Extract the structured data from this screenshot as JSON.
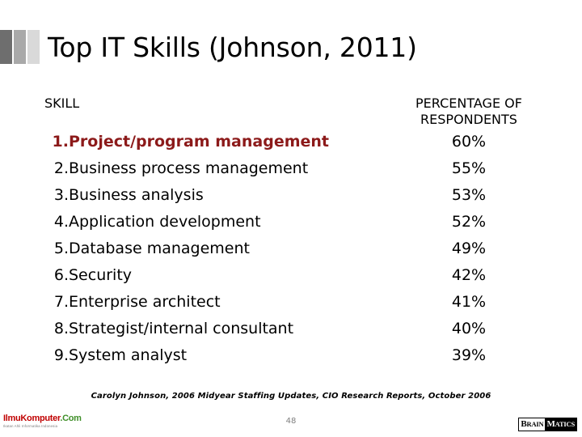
{
  "slide": {
    "title": "Top IT Skills (Johnson, 2011)",
    "page_number": "48",
    "citation": "Carolyn Johnson, 2006 Midyear Staffing Updates, CIO Research Reports, October 2006",
    "accent_colors": [
      "#6e6e6e",
      "#a9a9a9",
      "#d9d9d9"
    ],
    "highlight_color": "#8c1a1a"
  },
  "table": {
    "headers": {
      "skill": "SKILL",
      "percentage_line1": "PERCENTAGE OF",
      "percentage_line2": "RESPONDENTS"
    },
    "rows": [
      {
        "num": "1.",
        "skill": "Project/program management",
        "percentage": "60%",
        "highlighted": true
      },
      {
        "num": "2.",
        "skill": "Business process management",
        "percentage": "55%",
        "highlighted": false
      },
      {
        "num": "3.",
        "skill": "Business analysis",
        "percentage": "53%",
        "highlighted": false
      },
      {
        "num": "4.",
        "skill": "Application development",
        "percentage": "52%",
        "highlighted": false
      },
      {
        "num": "5.",
        "skill": "Database management",
        "percentage": "49%",
        "highlighted": false
      },
      {
        "num": "6.",
        "skill": "Security",
        "percentage": "42%",
        "highlighted": false
      },
      {
        "num": "7.",
        "skill": "Enterprise architect",
        "percentage": "41%",
        "highlighted": false
      },
      {
        "num": "8.",
        "skill": "Strategist/internal consultant",
        "percentage": "40%",
        "highlighted": false
      },
      {
        "num": "9.",
        "skill": "System analyst",
        "percentage": "39%",
        "highlighted": false
      }
    ]
  },
  "logos": {
    "left": {
      "name_part1": "IlmuKomputer",
      "name_part2": ".Com",
      "tagline": "Ikatan Ahli Informatika Indonesia"
    },
    "right": {
      "part1": "B",
      "part1_rest": "RAIN",
      "part2": "M",
      "part2_rest": "ATICS"
    }
  },
  "chart_data": {
    "type": "table",
    "title": "Top IT Skills (Johnson, 2011)",
    "categories": [
      "Project/program management",
      "Business process management",
      "Business analysis",
      "Application development",
      "Database management",
      "Security",
      "Enterprise architect",
      "Strategist/internal consultant",
      "System analyst"
    ],
    "values": [
      60,
      55,
      53,
      52,
      49,
      42,
      41,
      40,
      39
    ],
    "xlabel": "SKILL",
    "ylabel": "PERCENTAGE OF RESPONDENTS",
    "ylim": [
      0,
      100
    ],
    "unit": "%",
    "grid": false,
    "legend": "none"
  }
}
